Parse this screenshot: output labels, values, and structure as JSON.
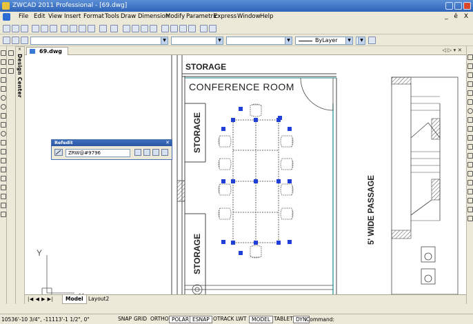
{
  "window": {
    "title": "ZWCAD 2011 Professional - [69.dwg]"
  },
  "menu": {
    "items": [
      "File",
      "Edit",
      "View",
      "Insert",
      "Format",
      "Tools",
      "Draw",
      "Dimension",
      "Modify",
      "Parametric",
      "Express",
      "Window",
      "Help"
    ],
    "window_controls": "_ ê X"
  },
  "properties_toolbar": {
    "linetype_value": "ByLayer"
  },
  "document": {
    "tab_label": "69.dwg",
    "tab_nav": "◁ ▷ ▾ ✕"
  },
  "design_center": {
    "label": "Design Center",
    "close": "×"
  },
  "drawing": {
    "storage_top": "STORAGE",
    "conference_room": "CONFERENCE ROOM",
    "storage_mid": "STORAGE",
    "storage_low": "STORAGE",
    "passage": "5' WIDE PASSAGE",
    "ucs_y": "Y",
    "ucs_x": "X"
  },
  "refedit": {
    "title": "Refedit",
    "close": "✕",
    "field_value": "ZRW@#9796"
  },
  "layout_tabs": {
    "nav": "|◀ ◀ ▶ ▶|",
    "model": "Model",
    "layout2": "Layout2"
  },
  "status": {
    "coordinates": "10536'-10 3/4\",  -11113'-1 1/2\",  0\"",
    "buttons": [
      "SNAP",
      "GRID",
      "ORTHO",
      "POLAR",
      "ESNAP",
      "OTRACK",
      "LWT",
      "MODEL",
      "TABLET",
      "DYN"
    ],
    "active_buttons": [
      "POLAR",
      "ESNAP",
      "MODEL",
      "DYN"
    ],
    "command_label": "Command:"
  },
  "colors": {
    "titlebar": "#2f63b8",
    "grip": "#1f3fd6",
    "wall_accent": "#1a8a8a"
  }
}
